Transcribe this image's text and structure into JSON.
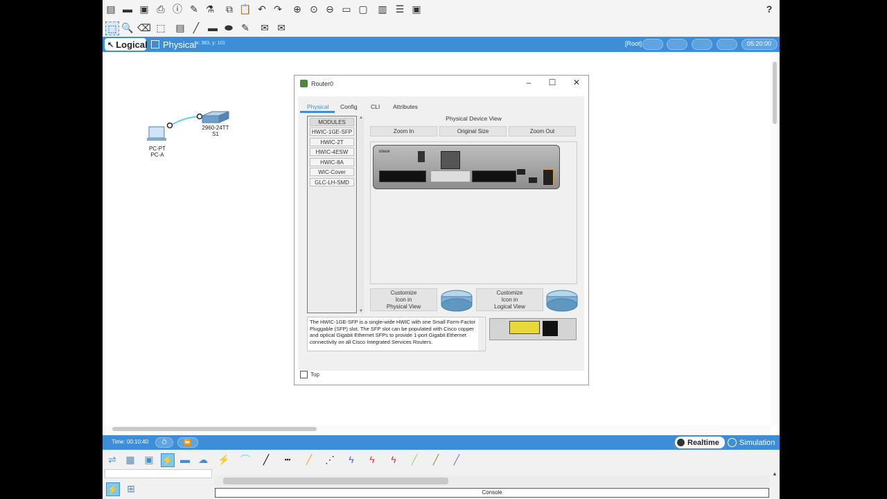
{
  "help": {
    "label": "?"
  },
  "modebar": {
    "logical": "Logical",
    "physical": "Physical",
    "coords": "x: 383, y: 101",
    "root": "[Root]",
    "clock": "05:20:00"
  },
  "topology": {
    "pc_type": "PC-PT",
    "pc_name": "PC-A",
    "switch_type": "2960-24TT",
    "switch_name": "S1"
  },
  "dialog": {
    "title": "Router0",
    "tabs": [
      "Physical",
      "Config",
      "CLI",
      "Attributes"
    ],
    "modules_header": "MODULES",
    "modules": [
      "HWIC-1GE-SFP",
      "HWIC-2T",
      "HWIC-4ESW",
      "HWIC-8A",
      "WIC-Cover",
      "GLC-LH-SMD"
    ],
    "view_title": "Physical Device View",
    "zoom_in": "Zoom In",
    "original_size": "Original Size",
    "zoom_out": "Zoom Out",
    "customize_physical": "Customize\nIcon in\nPhysical View",
    "customize_logical": "Customize\nIcon in\nLogical View",
    "description": "The HWIC-1GE-SFP is a single-wide HWIC with one Small Form-Factor Pluggable (SFP) slot. The SFP slot can be populated with Cisco copper and optical Gigabit Ethernet SFPs to provide 1-port Gigabit Ethernet connectivity on all Cisco Integrated Services Routers.",
    "top_label": "Top",
    "router_brand": "cisco"
  },
  "timebar": {
    "time": "Time: 00:10:40",
    "realtime": "Realtime",
    "simulation": "Simulation"
  },
  "console": {
    "label": "Console"
  },
  "colors": {
    "accent": "#3d8ed6",
    "link": "#5fd0f0"
  }
}
